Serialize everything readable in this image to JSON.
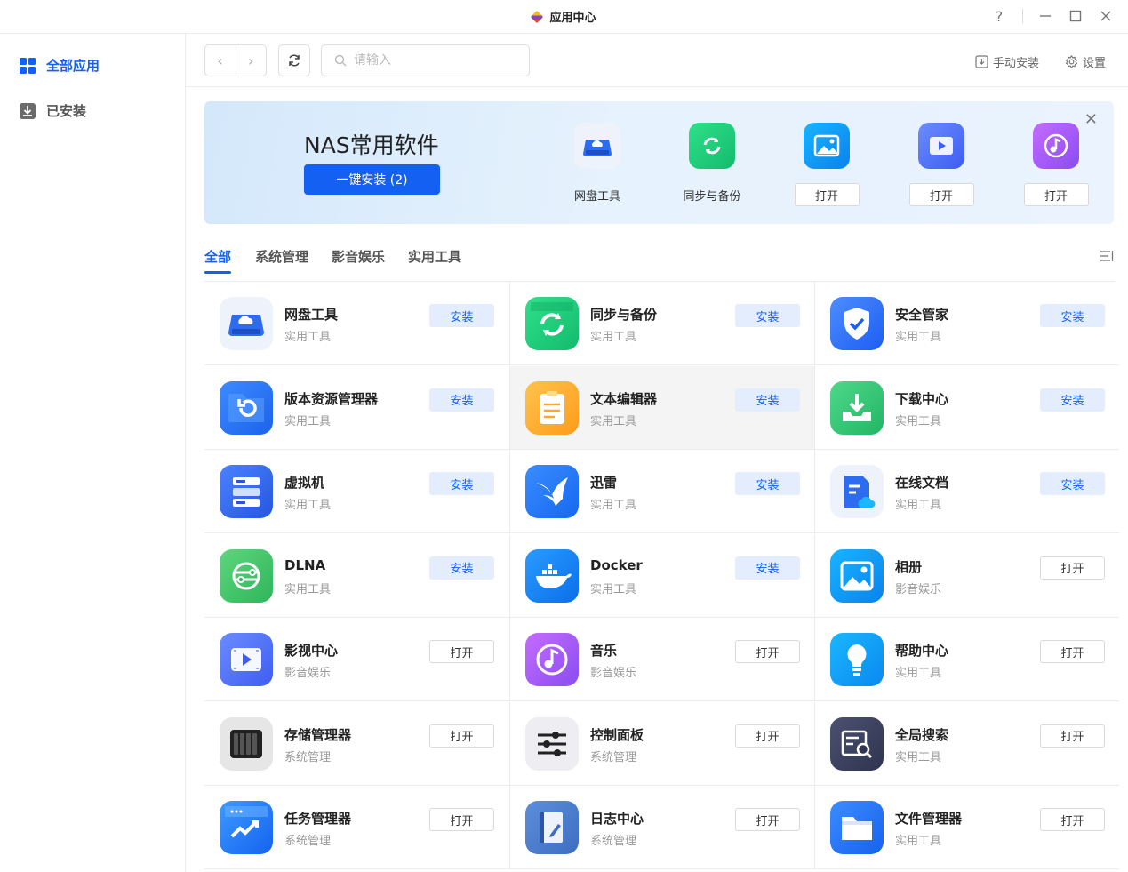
{
  "window": {
    "title": "应用中心",
    "help": "?",
    "minimize": "—",
    "maximize": "☐",
    "close": "✕"
  },
  "sidebar": {
    "items": [
      {
        "label": "全部应用",
        "active": true
      },
      {
        "label": "已安装",
        "active": false
      }
    ]
  },
  "toolbar": {
    "back": "‹",
    "forward": "›",
    "search_placeholder": "请输入",
    "manual_install": "手动安装",
    "settings": "设置"
  },
  "banner": {
    "title": "NAS常用软件",
    "install_all": "一键安装 (2)",
    "close": "✕",
    "apps": [
      {
        "label": "网盘工具",
        "type": "label"
      },
      {
        "label": "同步与备份",
        "type": "label"
      },
      {
        "label": "打开",
        "type": "open"
      },
      {
        "label": "打开",
        "type": "open"
      },
      {
        "label": "打开",
        "type": "open"
      }
    ]
  },
  "tabs": [
    "全部",
    "系统管理",
    "影音娱乐",
    "实用工具"
  ],
  "apps": [
    {
      "name": "网盘工具",
      "category": "实用工具",
      "action": "安装",
      "icon": "cloud-drive-icon"
    },
    {
      "name": "同步与备份",
      "category": "实用工具",
      "action": "安装",
      "icon": "sync-backup-icon"
    },
    {
      "name": "安全管家",
      "category": "实用工具",
      "action": "安装",
      "icon": "shield-icon"
    },
    {
      "name": "版本资源管理器",
      "category": "实用工具",
      "action": "安装",
      "icon": "version-folder-icon"
    },
    {
      "name": "文本编辑器",
      "category": "实用工具",
      "action": "安装",
      "icon": "notepad-icon"
    },
    {
      "name": "下载中心",
      "category": "实用工具",
      "action": "安装",
      "icon": "download-icon"
    },
    {
      "name": "虚拟机",
      "category": "实用工具",
      "action": "安装",
      "icon": "server-icon"
    },
    {
      "name": "迅雷",
      "category": "实用工具",
      "action": "安装",
      "icon": "thunder-bird-icon"
    },
    {
      "name": "在线文档",
      "category": "实用工具",
      "action": "安装",
      "icon": "online-doc-icon"
    },
    {
      "name": "DLNA",
      "category": "实用工具",
      "action": "安装",
      "icon": "dlna-icon"
    },
    {
      "name": "Docker",
      "category": "实用工具",
      "action": "安装",
      "icon": "docker-whale-icon"
    },
    {
      "name": "相册",
      "category": "影音娱乐",
      "action": "打开",
      "icon": "photo-album-icon"
    },
    {
      "name": "影视中心",
      "category": "影音娱乐",
      "action": "打开",
      "icon": "video-icon"
    },
    {
      "name": "音乐",
      "category": "影音娱乐",
      "action": "打开",
      "icon": "music-note-icon"
    },
    {
      "name": "帮助中心",
      "category": "实用工具",
      "action": "打开",
      "icon": "lightbulb-icon"
    },
    {
      "name": "存储管理器",
      "category": "系统管理",
      "action": "打开",
      "icon": "storage-drives-icon"
    },
    {
      "name": "控制面板",
      "category": "系统管理",
      "action": "打开",
      "icon": "sliders-icon"
    },
    {
      "name": "全局搜索",
      "category": "实用工具",
      "action": "打开",
      "icon": "global-search-icon"
    },
    {
      "name": "任务管理器",
      "category": "系统管理",
      "action": "打开",
      "icon": "task-chart-icon"
    },
    {
      "name": "日志中心",
      "category": "系统管理",
      "action": "打开",
      "icon": "log-book-icon"
    },
    {
      "name": "文件管理器",
      "category": "实用工具",
      "action": "打开",
      "icon": "folder-icon"
    }
  ],
  "colors": {
    "accent": "#1460f2",
    "install_bg": "#e3edfe",
    "highlight_row": "#f4f4f4"
  }
}
